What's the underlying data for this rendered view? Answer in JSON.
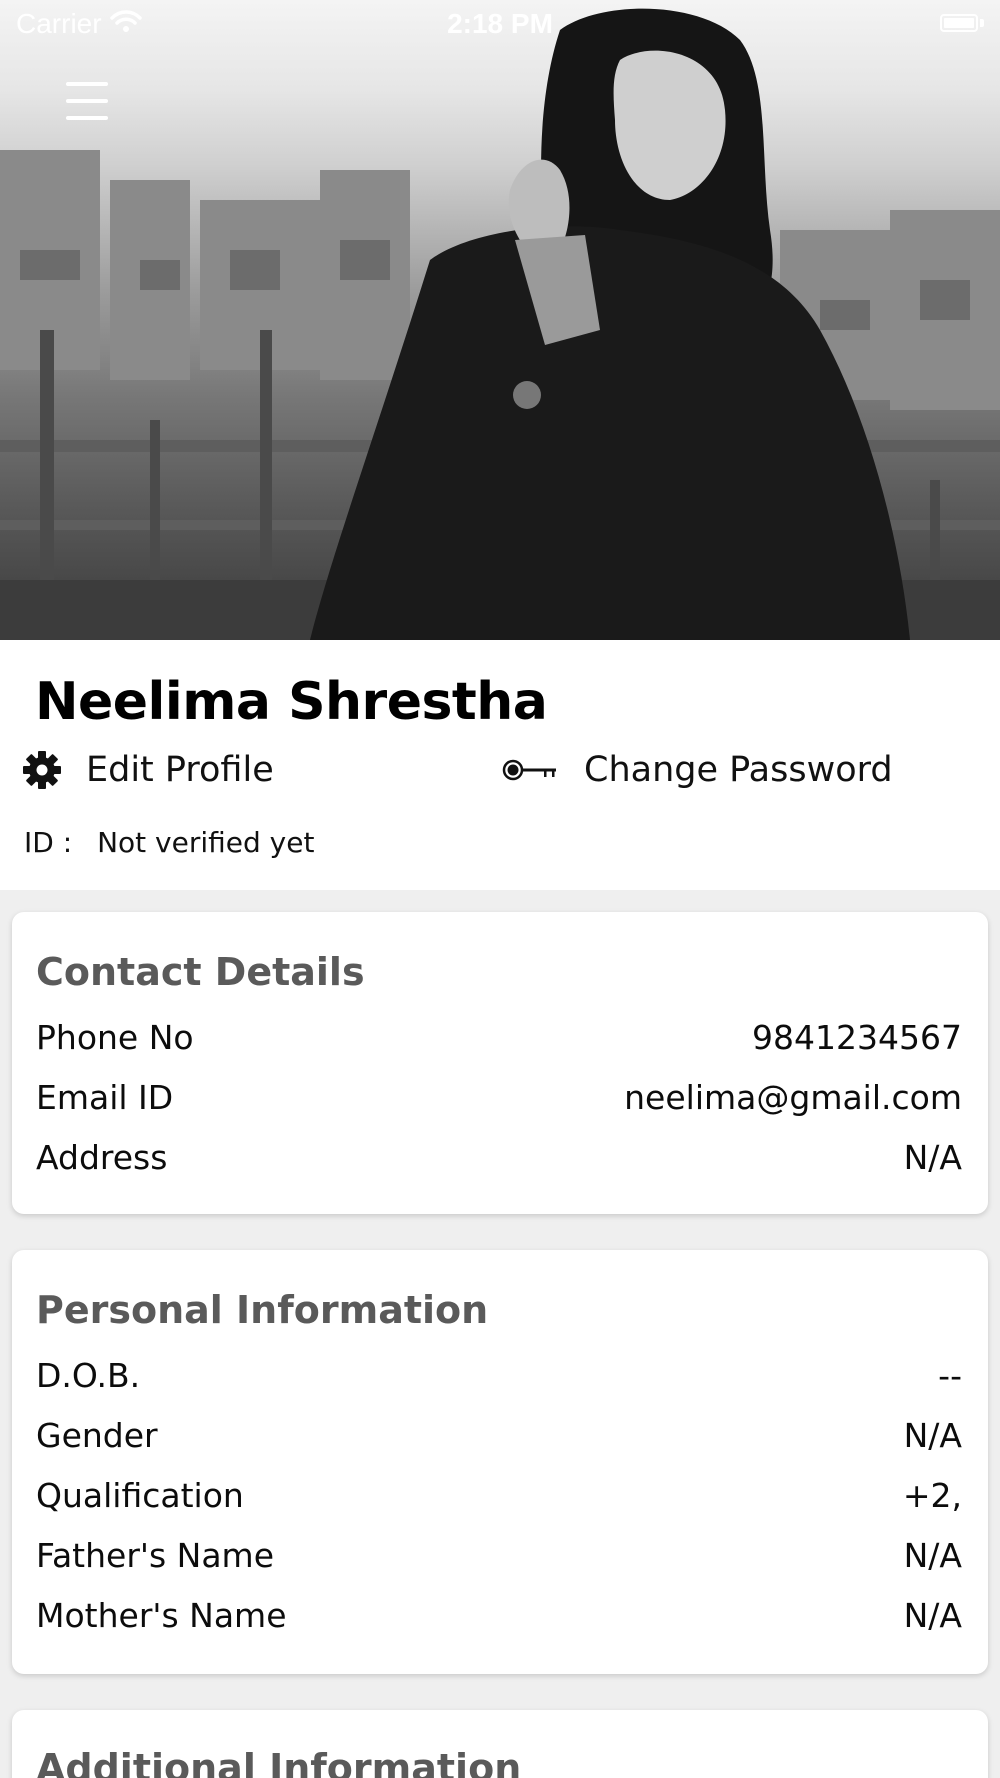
{
  "status_bar": {
    "carrier": "Carrier",
    "time": "2:18 PM"
  },
  "profile": {
    "name": "Neelima Shrestha",
    "edit_profile_label": "Edit Profile",
    "change_password_label": "Change Password",
    "id_label": "ID :",
    "id_value": "Not verified yet"
  },
  "contact_details": {
    "title": "Contact Details",
    "rows": [
      {
        "label": "Phone No",
        "value": "9841234567"
      },
      {
        "label": "Email ID",
        "value": "neelima@gmail.com"
      },
      {
        "label": "Address",
        "value": "N/A"
      }
    ]
  },
  "personal_information": {
    "title": "Personal Information",
    "rows": [
      {
        "label": "D.O.B.",
        "value": "--"
      },
      {
        "label": "Gender",
        "value": "N/A"
      },
      {
        "label": "Qualification",
        "value": "+2,"
      },
      {
        "label": "Father's Name",
        "value": "N/A"
      },
      {
        "label": "Mother's Name",
        "value": "N/A"
      }
    ]
  },
  "additional_information": {
    "title": "Additional Information"
  },
  "icons": {
    "menu": "hamburger-menu-icon",
    "edit_profile": "gear-icon",
    "change_password": "key-icon",
    "wifi": "wifi-icon",
    "battery": "battery-icon"
  }
}
